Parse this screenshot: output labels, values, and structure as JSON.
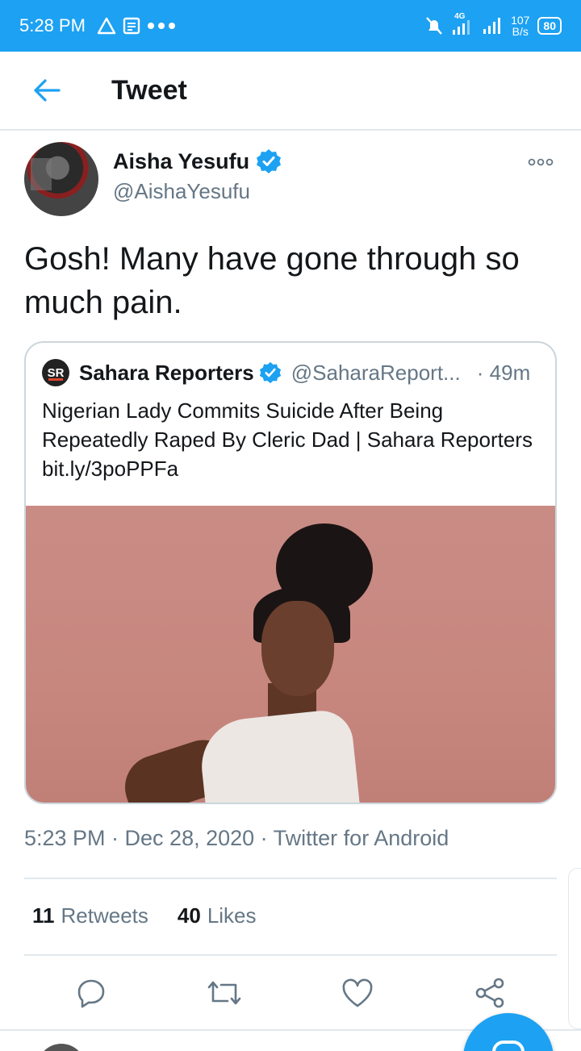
{
  "status_bar": {
    "time": "5:28 PM",
    "network": "4G",
    "speed_value": "107",
    "speed_unit": "B/s",
    "battery": "80"
  },
  "header": {
    "title": "Tweet"
  },
  "tweet": {
    "author_name": "Aisha Yesufu",
    "author_handle": "@AishaYesufu",
    "text": "Gosh! Many have gone through so much pain.",
    "timestamp": "5:23 PM · Dec 28, 2020 · Twitter for Android"
  },
  "quoted": {
    "logo_text": "SR",
    "name": "Sahara Reporters",
    "handle": "@SaharaReport...",
    "time": "· 49m",
    "text": "Nigerian Lady Commits Suicide After Being Repeatedly Raped By Cleric Dad | Sahara Reporters bit.ly/3poPPFa"
  },
  "stats": {
    "retweets_count": "11",
    "retweets_label": "Retweets",
    "likes_count": "40",
    "likes_label": "Likes"
  },
  "colors": {
    "brand": "#1da1f2",
    "secondary_text": "#657786",
    "divider": "#e1e8ed"
  },
  "icons": [
    "back-arrow-icon",
    "more-icon",
    "verified-icon",
    "reply-icon",
    "retweet-icon",
    "like-icon",
    "share-icon",
    "compose-icon"
  ]
}
